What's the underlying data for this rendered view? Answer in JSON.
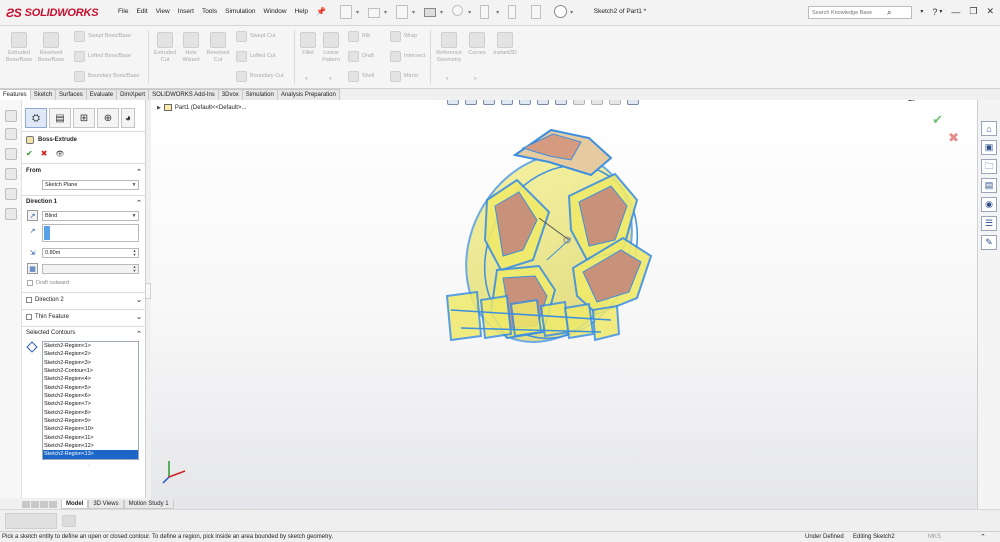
{
  "app": {
    "brand": "SOLIDWORKS",
    "document_title": "Sketch2 of Part1 *"
  },
  "menu": [
    "File",
    "Edit",
    "View",
    "Insert",
    "Tools",
    "Simulation",
    "Window",
    "Help"
  ],
  "search": {
    "placeholder": "Search Knowledge Base"
  },
  "ribbon": {
    "extruded_boss": "Extruded\nBoss/Base",
    "revolved_boss": "Revolved\nBoss/Base",
    "swept_boss": "Swept Boss/Base",
    "lofted_boss": "Lofted Boss/Base",
    "boundary_boss": "Boundary Boss/Base",
    "extruded_cut": "Extruded\nCut",
    "hole_wizard": "Hole\nWizard",
    "revolved_cut": "Revolved\nCut",
    "swept_cut": "Swept Cut",
    "lofted_cut": "Lofted Cut",
    "boundary_cut": "Boundary Cut",
    "fillet": "Fillet",
    "linear_pattern": "Linear\nPattern",
    "rib": "Rib",
    "draft": "Draft",
    "shell": "Shell",
    "wrap": "Wrap",
    "intersect": "Intersect",
    "mirror": "Mirror",
    "reference_geometry": "Reference\nGeometry",
    "curves": "Curves",
    "instant3d": "Instant3D"
  },
  "command_tabs": [
    "Features",
    "Sketch",
    "Surfaces",
    "Evaluate",
    "DimXpert",
    "SOLIDWORKS Add-Ins",
    "3Dvox",
    "Simulation",
    "Analysis Preparation"
  ],
  "property_manager": {
    "title": "Boss-Extrude",
    "from": {
      "label": "From",
      "value": "Sketch Plane"
    },
    "direction1": {
      "label": "Direction 1",
      "end_condition": "Blind",
      "depth": "0.80m",
      "draft_outward": "Draft outward"
    },
    "direction2": {
      "label": "Direction 2"
    },
    "thin_feature": {
      "label": "Thin Feature"
    },
    "selected_contours": {
      "label": "Selected Contours",
      "items": [
        "Sketch2-Region<1>",
        "Sketch2-Region<2>",
        "Sketch2-Region<3>",
        "Sketch2-Contour<1>",
        "Sketch2-Region<4>",
        "Sketch2-Region<5>",
        "Sketch2-Region<6>",
        "Sketch2-Region<7>",
        "Sketch2-Region<8>",
        "Sketch2-Region<9>",
        "Sketch2-Region<10>",
        "Sketch2-Region<11>",
        "Sketch2-Region<12>",
        "Sketch2-Region<13>"
      ],
      "selected_index": 13
    }
  },
  "viewport": {
    "tree_node": "Part1 (Default<<Default>..."
  },
  "bottom_tabs": [
    "Model",
    "3D Views",
    "Motion Study 1"
  ],
  "status": {
    "message": "Pick a sketch entity to define an open or closed contour. To define a region, pick inside an area bounded by sketch geometry.",
    "definition": "Under Defined",
    "editing": "Editing Sketch2",
    "units": "MKS"
  },
  "colors": {
    "accent": "#1b66c6",
    "brand": "#c8102e",
    "model_yellow": "#f0ea6a",
    "model_brown": "#c8927a",
    "model_blue": "#3d8fe0"
  }
}
